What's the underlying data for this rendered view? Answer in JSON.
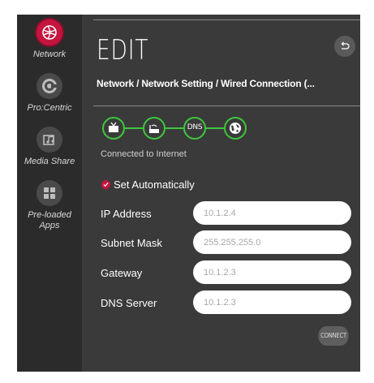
{
  "sidebar": {
    "items": [
      {
        "label": "Network",
        "icon": "network-icon",
        "active": true
      },
      {
        "label": "Pro:Centric",
        "icon": "procentric-icon",
        "active": false
      },
      {
        "label": "Media Share",
        "icon": "media-share-icon",
        "active": false
      },
      {
        "label": "Pre-loaded\nApps",
        "icon": "apps-grid-icon",
        "active": false
      }
    ]
  },
  "header": {
    "title": "EDIT",
    "breadcrumb": "Network / Network Setting / Wired Connection (...",
    "back_icon": "back-arrow-icon"
  },
  "connection": {
    "nodes": [
      "tv-icon",
      "router-icon",
      "DNS",
      "globe-icon"
    ],
    "status": "Connected to Internet",
    "status_color": "#3fc63f"
  },
  "form": {
    "auto_label": "Set Automatically",
    "auto_checked": true,
    "fields": [
      {
        "label": "IP Address",
        "value": "10.1.2.4"
      },
      {
        "label": "Subnet Mask",
        "value": "255.255.255.0"
      },
      {
        "label": "Gateway",
        "value": "10.1.2.3"
      },
      {
        "label": "DNS Server",
        "value": "10.1.2.3"
      }
    ],
    "connect_label": "CONNECT"
  },
  "colors": {
    "accent": "#c5153f",
    "sidebar_bg": "#2b2b2b",
    "panel_bg": "#3a3a3a",
    "success": "#3fc63f"
  }
}
